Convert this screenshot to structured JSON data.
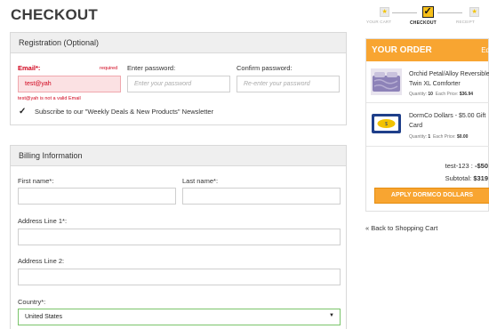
{
  "page": {
    "title": "CHECKOUT"
  },
  "steps": [
    {
      "label": "YOUR CART",
      "state": "done"
    },
    {
      "label": "CHECKOUT",
      "state": "active"
    },
    {
      "label": "RECEIPT",
      "state": "todo"
    }
  ],
  "registration": {
    "heading": "Registration (Optional)",
    "email_label": "Email*:",
    "required_text": "required",
    "email_value": "test@yah",
    "email_error": "test@yah is not a valid Email",
    "password_label": "Enter password:",
    "password_placeholder": "Enter your password",
    "confirm_label": "Confirm password:",
    "confirm_placeholder": "Re-enter your password",
    "newsletter_label": "Subscribe to our \"Weekly Deals & New Products\" Newsletter",
    "newsletter_checked": true
  },
  "billing": {
    "heading": "Billing Information",
    "first_name_label": "First name*:",
    "last_name_label": "Last name*:",
    "address1_label": "Address Line 1*:",
    "address2_label": "Address Line 2:",
    "country_label": "Country*:",
    "country_value": "United States"
  },
  "order": {
    "heading": "YOUR ORDER",
    "edit_label": "Ed",
    "items": [
      {
        "name": "Orchid Petal/Alloy Reversible Twin XL Comforter",
        "quantity_label": "Quantity:",
        "quantity": "10",
        "price_label": "Each Price:",
        "price": "$36.94"
      },
      {
        "name": "DormCo Dollars - $5.00 Gift Card",
        "quantity_label": "Quantity:",
        "quantity": "1",
        "price_label": "Each Price:",
        "price": "$0.00"
      }
    ],
    "coupon_label": "test-123 :",
    "coupon_value": "-$50",
    "subtotal_label": "Subtotal:",
    "subtotal_value": "$319",
    "apply_button": "APPLY DORMCO DOLLARS",
    "back_link": "« Back to Shopping Cart"
  },
  "colors": {
    "accent": "#f8a531",
    "error": "#d0021b",
    "valid": "#7ac46a"
  }
}
